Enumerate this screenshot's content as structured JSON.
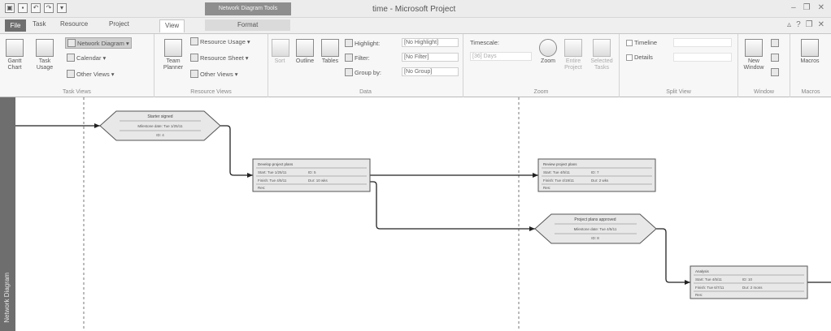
{
  "window": {
    "title": "time - Microsoft Project",
    "context_tab_title": "Network Diagram Tools"
  },
  "tabs": {
    "file": "File",
    "task": "Task",
    "resource": "Resource",
    "project": "Project",
    "view": "View",
    "format": "Format"
  },
  "ribbon": {
    "task_views": {
      "label": "Task Views",
      "gantt": "Gantt Chart",
      "task_usage": "Task Usage",
      "network_diagram": "Network Diagram",
      "calendar": "Calendar",
      "other_views": "Other Views"
    },
    "resource_views": {
      "label": "Resource Views",
      "team_planner": "Team Planner",
      "resource_usage": "Resource Usage",
      "resource_sheet": "Resource Sheet",
      "other_views": "Other Views"
    },
    "data": {
      "label": "Data",
      "sort": "Sort",
      "outline": "Outline",
      "tables": "Tables",
      "highlight_label": "Highlight:",
      "highlight_value": "[No Highlight]",
      "filter_label": "Filter:",
      "filter_value": "[No Filter]",
      "group_label": "Group by:",
      "group_value": "[No Group]"
    },
    "zoom": {
      "label": "Zoom",
      "timescale_label": "Timescale:",
      "timescale_value": "[36] Days",
      "zoom": "Zoom",
      "entire_project": "Entire Project",
      "selected_tasks": "Selected Tasks"
    },
    "split_view": {
      "label": "Split View",
      "timeline": "Timeline",
      "details": "Details"
    },
    "window": {
      "label": "Window",
      "new_window": "New Window"
    },
    "macros": {
      "label": "Macros",
      "macros": "Macros"
    }
  },
  "side_panel": {
    "label": "Network Diagram"
  },
  "diagram": {
    "nodes": [
      {
        "type": "milestone",
        "title": "Starter signed",
        "line1": "Milestone date: Tue 1/25/11",
        "line2": "ID: 4"
      },
      {
        "type": "task",
        "title": "Develop project plans",
        "start": "Start: Tue 1/25/11",
        "id": "ID: 5",
        "finish": "Finish: Tue 4/5/11",
        "dur": "Dur: 10 wks",
        "res": "Res:"
      },
      {
        "type": "task",
        "title": "Review project plans",
        "start": "Start: Tue 4/5/11",
        "id": "ID: 7",
        "finish": "Finish: Tue 4/19/11",
        "dur": "Dur: 2 wks",
        "res": "Res:"
      },
      {
        "type": "milestone",
        "title": "Project plans approved",
        "line1": "Milestone date: Tue 4/5/11",
        "line2": "ID: 8"
      },
      {
        "type": "task",
        "title": "Analysis",
        "start": "Start: Tue 4/5/11",
        "id": "ID: 10",
        "finish": "Finish: Tue 6/7/11",
        "dur": "Dur: 2 mons",
        "res": "Res:"
      }
    ]
  },
  "colors": {
    "accent_dark": "#6e6e6e",
    "node_fill": "#e8e8e8",
    "node_border": "#555555"
  }
}
